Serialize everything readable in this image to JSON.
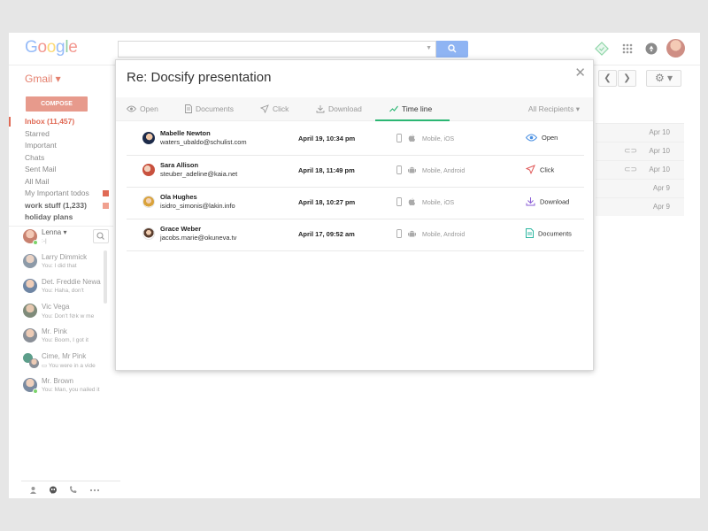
{
  "header": {
    "logo": [
      "G",
      "o",
      "o",
      "g",
      "l",
      "e"
    ],
    "logo_colors": [
      "#4285f4",
      "#ea4335",
      "#fbbc05",
      "#4285f4",
      "#34a853",
      "#ea4335"
    ],
    "app_label": "Gmail ▾",
    "search_placeholder": ""
  },
  "sidebar": {
    "compose_label": "COMPOSE",
    "items": [
      {
        "label": "Inbox (11,457)"
      },
      {
        "label": "Starred"
      },
      {
        "label": "Important"
      },
      {
        "label": "Chats"
      },
      {
        "label": "Sent Mail"
      },
      {
        "label": "All Mail"
      },
      {
        "label": "My Important todos"
      },
      {
        "label": "work stuff (1,233)"
      },
      {
        "label": "holiday plans"
      }
    ],
    "tag_colors": [
      "#e06a55",
      "#f0a08f"
    ]
  },
  "chat": {
    "me": {
      "name": "Lenna ▾",
      "status": ":-|"
    },
    "contacts": [
      {
        "name": "Larry Dimmick",
        "message": "You: I did that"
      },
      {
        "name": "Det. Freddie Newa",
        "message": "You: Haha, don't"
      },
      {
        "name": "Vic Vega",
        "message": "You: Don't f⊘k w me"
      },
      {
        "name": "Mr. Pink",
        "message": "You: Boom, I got it"
      },
      {
        "name": "Cime, Mr Pink",
        "message": "You were in a vide"
      },
      {
        "name": "Mr. Brown",
        "message": "You: Man, you nailed it"
      }
    ]
  },
  "mail_list": {
    "dates": [
      "Apr 10",
      "Apr 10",
      "Apr 10",
      "Apr 9",
      "Apr 9"
    ]
  },
  "modal": {
    "title": "Re: Docsify presentation",
    "close_glyph": "✕",
    "tabs": [
      {
        "label": "Open",
        "icon": "eye-icon"
      },
      {
        "label": "Documents",
        "icon": "document-icon"
      },
      {
        "label": "Click",
        "icon": "cursor-icon"
      },
      {
        "label": "Download",
        "icon": "download-icon"
      },
      {
        "label": "Time line",
        "icon": "timeline-icon"
      }
    ],
    "active_tab": "Time line",
    "recipients_label": "All Recipients ▾",
    "rows": [
      {
        "name": "Mabelle Newton",
        "email": "waters_ubaldo@schulist.com",
        "date": "April 19, 10:34 pm",
        "device": "Mobile, iOS",
        "action": "Open",
        "action_color": "#4a90e2"
      },
      {
        "name": "Sara Allison",
        "email": "steuber_adeline@kaia.net",
        "date": "April 18, 11:49 pm",
        "device": "Mobile, Android",
        "action": "Click",
        "action_color": "#e05a5a"
      },
      {
        "name": "Ola Hughes",
        "email": "isidro_simonis@lakin.info",
        "date": "April 18, 10:27 pm",
        "device": "Mobile, iOS",
        "action": "Download",
        "action_color": "#8a5cd6"
      },
      {
        "name": "Grace Weber",
        "email": "jacobs.marie@okuneva.tv",
        "date": "April 17, 09:52 am",
        "device": "Mobile, Android",
        "action": "Documents",
        "action_color": "#2bb6a0"
      }
    ]
  },
  "colors": {
    "accent": "#2bb673",
    "gmail_red": "#e06a55"
  }
}
